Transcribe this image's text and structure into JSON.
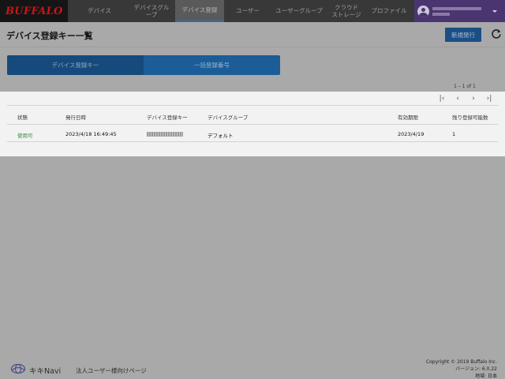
{
  "brand": {
    "logo_text": "BUFFALO"
  },
  "nav": {
    "items": [
      {
        "label": "デバイス"
      },
      {
        "label": "デバイスグループ"
      },
      {
        "label": "デバイス登録"
      },
      {
        "label": "ユーザー"
      },
      {
        "label": "ユーザーグループ"
      },
      {
        "label": "クラウド\nストレージ"
      },
      {
        "label": "プロファイル"
      }
    ],
    "active_index": 2
  },
  "page": {
    "title": "デバイス登録キー一覧",
    "new_button": "新規発行"
  },
  "toggle": {
    "tabs": [
      {
        "label": "デバイス登録キー"
      },
      {
        "label": "一括登録番号"
      }
    ]
  },
  "pagination": {
    "count_text": "1 – 1 of 1"
  },
  "table": {
    "headers": [
      "状態",
      "発行日時",
      "デバイス登録キー",
      "デバイスグループ",
      "有効期限",
      "残り登録可能数"
    ],
    "rows": [
      {
        "status": "使用可",
        "issued": "2023/4/18 16:49:45",
        "device_group": "デフォルト",
        "expiry": "2023/4/19",
        "remaining": "1"
      }
    ]
  },
  "footer": {
    "brand": "キキNavi",
    "tagline": "法人ユーザー様向けページ",
    "copyright": "Copyright © 2019 Buffalo Inc.",
    "version": "バージョン: 6.0.22",
    "region": "地域: 日本"
  },
  "colors": {
    "logo_red": "#c8151b",
    "accent_blue": "#1c5c97",
    "user_purple": "#4a3570",
    "status_green": "#3a8a3a"
  }
}
